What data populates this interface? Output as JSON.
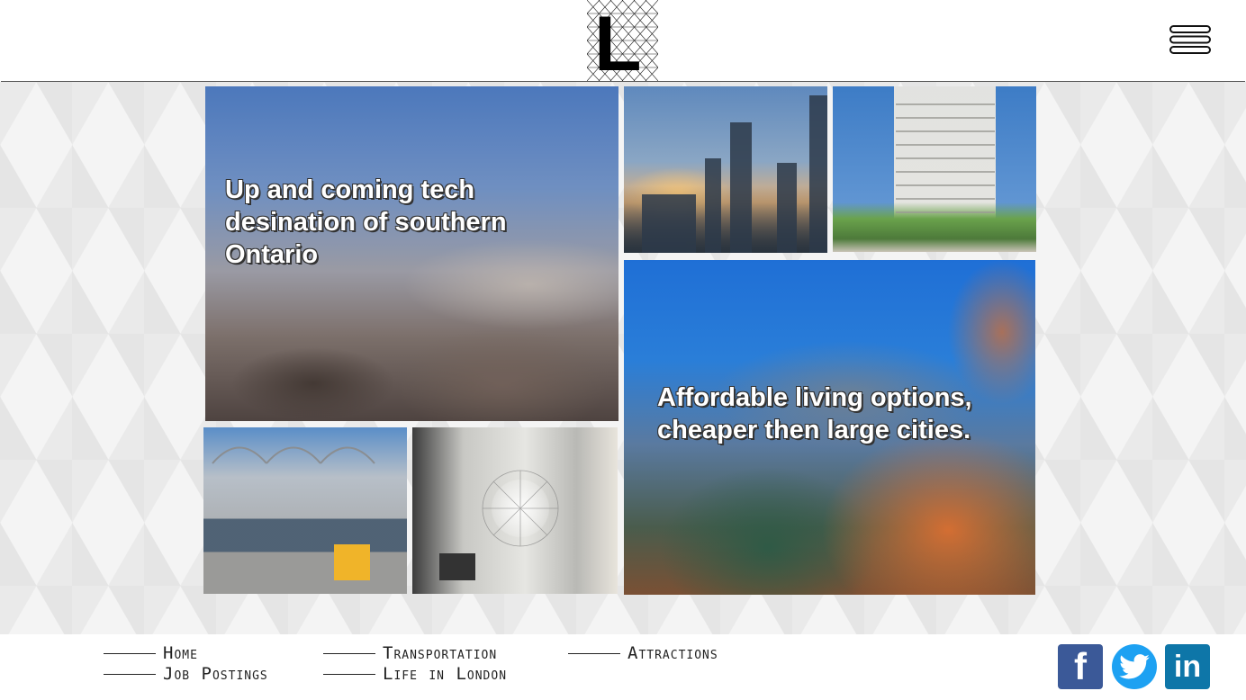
{
  "header": {
    "logo_letter": "L",
    "menu_icon": "hamburger-icon"
  },
  "tiles": {
    "hero_left_text": "Up and coming tech desination of southern Ontario",
    "hero_right_text": "Affordable living options, cheaper then large cities."
  },
  "footer": {
    "nav": [
      {
        "label": "Home"
      },
      {
        "label": "Job Postings"
      },
      {
        "label": "Transportation"
      },
      {
        "label": "Life in London"
      },
      {
        "label": "Attractions"
      }
    ],
    "social": [
      {
        "name": "facebook-icon",
        "glyph": "f",
        "color": "#3b5998"
      },
      {
        "name": "twitter-icon",
        "color": "#1da1f2"
      },
      {
        "name": "linkedin-icon",
        "glyph": "in",
        "color": "#0e76a8"
      }
    ]
  }
}
